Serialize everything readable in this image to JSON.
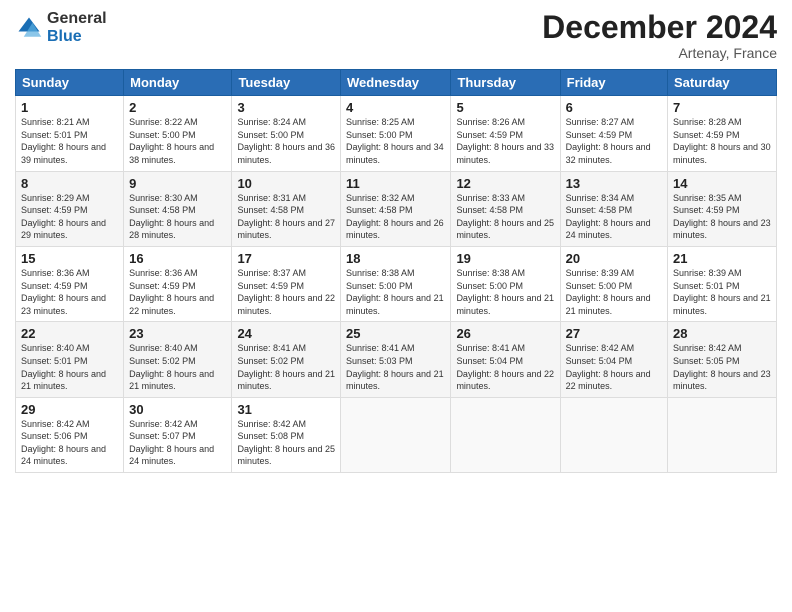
{
  "logo": {
    "general": "General",
    "blue": "Blue"
  },
  "header": {
    "month": "December 2024",
    "location": "Artenay, France"
  },
  "weekdays": [
    "Sunday",
    "Monday",
    "Tuesday",
    "Wednesday",
    "Thursday",
    "Friday",
    "Saturday"
  ],
  "weeks": [
    [
      {
        "day": "1",
        "sunrise": "Sunrise: 8:21 AM",
        "sunset": "Sunset: 5:01 PM",
        "daylight": "Daylight: 8 hours and 39 minutes."
      },
      {
        "day": "2",
        "sunrise": "Sunrise: 8:22 AM",
        "sunset": "Sunset: 5:00 PM",
        "daylight": "Daylight: 8 hours and 38 minutes."
      },
      {
        "day": "3",
        "sunrise": "Sunrise: 8:24 AM",
        "sunset": "Sunset: 5:00 PM",
        "daylight": "Daylight: 8 hours and 36 minutes."
      },
      {
        "day": "4",
        "sunrise": "Sunrise: 8:25 AM",
        "sunset": "Sunset: 5:00 PM",
        "daylight": "Daylight: 8 hours and 34 minutes."
      },
      {
        "day": "5",
        "sunrise": "Sunrise: 8:26 AM",
        "sunset": "Sunset: 4:59 PM",
        "daylight": "Daylight: 8 hours and 33 minutes."
      },
      {
        "day": "6",
        "sunrise": "Sunrise: 8:27 AM",
        "sunset": "Sunset: 4:59 PM",
        "daylight": "Daylight: 8 hours and 32 minutes."
      },
      {
        "day": "7",
        "sunrise": "Sunrise: 8:28 AM",
        "sunset": "Sunset: 4:59 PM",
        "daylight": "Daylight: 8 hours and 30 minutes."
      }
    ],
    [
      {
        "day": "8",
        "sunrise": "Sunrise: 8:29 AM",
        "sunset": "Sunset: 4:59 PM",
        "daylight": "Daylight: 8 hours and 29 minutes."
      },
      {
        "day": "9",
        "sunrise": "Sunrise: 8:30 AM",
        "sunset": "Sunset: 4:58 PM",
        "daylight": "Daylight: 8 hours and 28 minutes."
      },
      {
        "day": "10",
        "sunrise": "Sunrise: 8:31 AM",
        "sunset": "Sunset: 4:58 PM",
        "daylight": "Daylight: 8 hours and 27 minutes."
      },
      {
        "day": "11",
        "sunrise": "Sunrise: 8:32 AM",
        "sunset": "Sunset: 4:58 PM",
        "daylight": "Daylight: 8 hours and 26 minutes."
      },
      {
        "day": "12",
        "sunrise": "Sunrise: 8:33 AM",
        "sunset": "Sunset: 4:58 PM",
        "daylight": "Daylight: 8 hours and 25 minutes."
      },
      {
        "day": "13",
        "sunrise": "Sunrise: 8:34 AM",
        "sunset": "Sunset: 4:58 PM",
        "daylight": "Daylight: 8 hours and 24 minutes."
      },
      {
        "day": "14",
        "sunrise": "Sunrise: 8:35 AM",
        "sunset": "Sunset: 4:59 PM",
        "daylight": "Daylight: 8 hours and 23 minutes."
      }
    ],
    [
      {
        "day": "15",
        "sunrise": "Sunrise: 8:36 AM",
        "sunset": "Sunset: 4:59 PM",
        "daylight": "Daylight: 8 hours and 23 minutes."
      },
      {
        "day": "16",
        "sunrise": "Sunrise: 8:36 AM",
        "sunset": "Sunset: 4:59 PM",
        "daylight": "Daylight: 8 hours and 22 minutes."
      },
      {
        "day": "17",
        "sunrise": "Sunrise: 8:37 AM",
        "sunset": "Sunset: 4:59 PM",
        "daylight": "Daylight: 8 hours and 22 minutes."
      },
      {
        "day": "18",
        "sunrise": "Sunrise: 8:38 AM",
        "sunset": "Sunset: 5:00 PM",
        "daylight": "Daylight: 8 hours and 21 minutes."
      },
      {
        "day": "19",
        "sunrise": "Sunrise: 8:38 AM",
        "sunset": "Sunset: 5:00 PM",
        "daylight": "Daylight: 8 hours and 21 minutes."
      },
      {
        "day": "20",
        "sunrise": "Sunrise: 8:39 AM",
        "sunset": "Sunset: 5:00 PM",
        "daylight": "Daylight: 8 hours and 21 minutes."
      },
      {
        "day": "21",
        "sunrise": "Sunrise: 8:39 AM",
        "sunset": "Sunset: 5:01 PM",
        "daylight": "Daylight: 8 hours and 21 minutes."
      }
    ],
    [
      {
        "day": "22",
        "sunrise": "Sunrise: 8:40 AM",
        "sunset": "Sunset: 5:01 PM",
        "daylight": "Daylight: 8 hours and 21 minutes."
      },
      {
        "day": "23",
        "sunrise": "Sunrise: 8:40 AM",
        "sunset": "Sunset: 5:02 PM",
        "daylight": "Daylight: 8 hours and 21 minutes."
      },
      {
        "day": "24",
        "sunrise": "Sunrise: 8:41 AM",
        "sunset": "Sunset: 5:02 PM",
        "daylight": "Daylight: 8 hours and 21 minutes."
      },
      {
        "day": "25",
        "sunrise": "Sunrise: 8:41 AM",
        "sunset": "Sunset: 5:03 PM",
        "daylight": "Daylight: 8 hours and 21 minutes."
      },
      {
        "day": "26",
        "sunrise": "Sunrise: 8:41 AM",
        "sunset": "Sunset: 5:04 PM",
        "daylight": "Daylight: 8 hours and 22 minutes."
      },
      {
        "day": "27",
        "sunrise": "Sunrise: 8:42 AM",
        "sunset": "Sunset: 5:04 PM",
        "daylight": "Daylight: 8 hours and 22 minutes."
      },
      {
        "day": "28",
        "sunrise": "Sunrise: 8:42 AM",
        "sunset": "Sunset: 5:05 PM",
        "daylight": "Daylight: 8 hours and 23 minutes."
      }
    ],
    [
      {
        "day": "29",
        "sunrise": "Sunrise: 8:42 AM",
        "sunset": "Sunset: 5:06 PM",
        "daylight": "Daylight: 8 hours and 24 minutes."
      },
      {
        "day": "30",
        "sunrise": "Sunrise: 8:42 AM",
        "sunset": "Sunset: 5:07 PM",
        "daylight": "Daylight: 8 hours and 24 minutes."
      },
      {
        "day": "31",
        "sunrise": "Sunrise: 8:42 AM",
        "sunset": "Sunset: 5:08 PM",
        "daylight": "Daylight: 8 hours and 25 minutes."
      },
      null,
      null,
      null,
      null
    ]
  ]
}
